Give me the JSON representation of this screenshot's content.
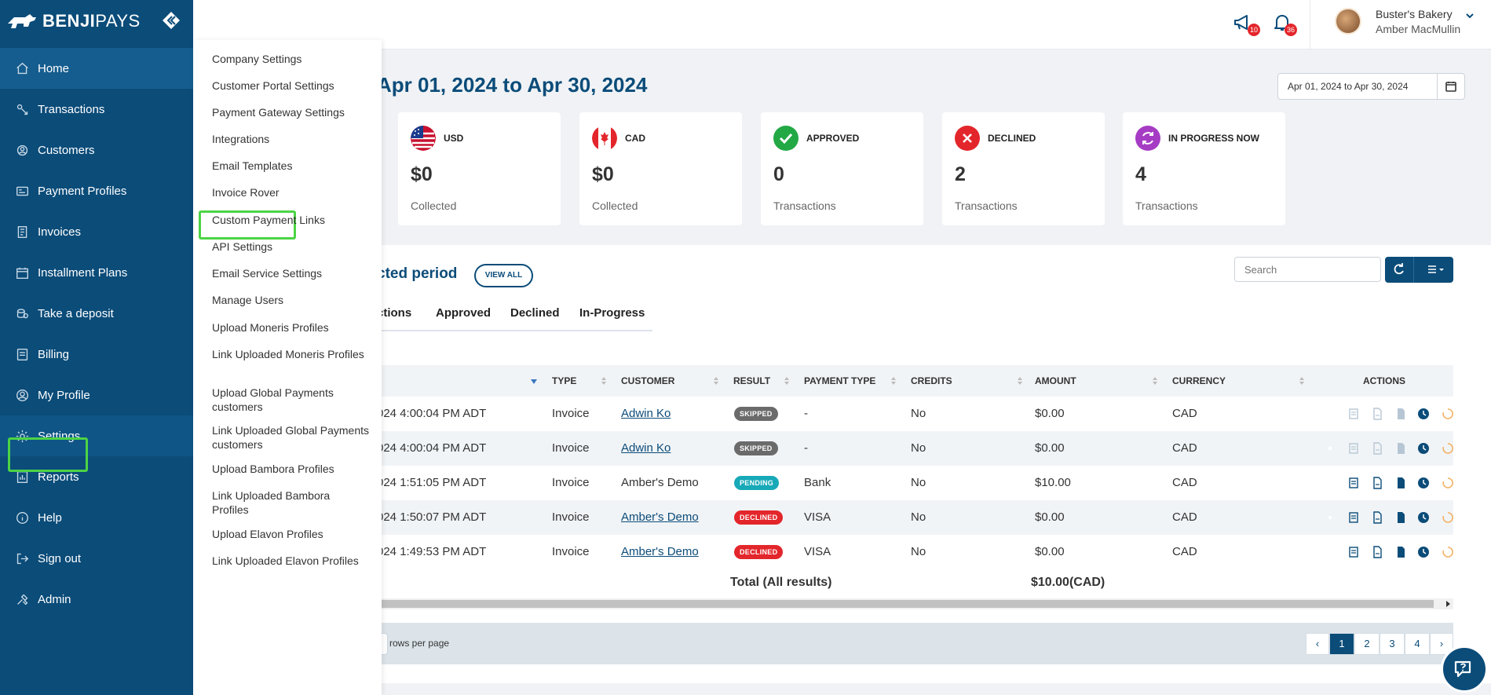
{
  "brand": {
    "name_bold": "BENJI",
    "name_light": "PAYS"
  },
  "colors": {
    "primary": "#0b4c79",
    "highlight": "#4cd445",
    "declined": "#e3262b",
    "approved": "#22a845",
    "pending": "#17a9b7",
    "skipped": "#6b6b6b",
    "in_progress": "#a63cc4"
  },
  "sidebar": {
    "items": [
      {
        "label": "Home",
        "icon": "home-icon"
      },
      {
        "label": "Transactions",
        "icon": "transactions-icon"
      },
      {
        "label": "Customers",
        "icon": "customers-icon"
      },
      {
        "label": "Payment Profiles",
        "icon": "payment-profiles-icon"
      },
      {
        "label": "Invoices",
        "icon": "invoice-icon"
      },
      {
        "label": "Installment Plans",
        "icon": "calendar-icon"
      },
      {
        "label": "Take a deposit",
        "icon": "deposit-icon"
      },
      {
        "label": "Billing",
        "icon": "billing-icon"
      },
      {
        "label": "My Profile",
        "icon": "profile-icon"
      },
      {
        "label": "Settings",
        "icon": "gear-icon"
      },
      {
        "label": "Reports",
        "icon": "reports-icon"
      },
      {
        "label": "Help",
        "icon": "help-icon"
      },
      {
        "label": "Sign out",
        "icon": "sign-out-icon"
      },
      {
        "label": "Admin",
        "icon": "admin-icon"
      }
    ]
  },
  "settings_menu": {
    "items": [
      "Company Settings",
      "Customer Portal Settings",
      "Payment Gateway Settings",
      "Integrations",
      "Email Templates",
      "Invoice Rover",
      "Custom Payment Links",
      "API Settings",
      "Email Service Settings",
      "Manage Users",
      "Upload Moneris Profiles",
      "Link Uploaded Moneris Profiles",
      "Upload Global Payments customers",
      "Link Uploaded Global Payments customers",
      "Upload Bambora Profiles",
      "Link Uploaded Bambora Profiles",
      "Upload Elavon Profiles",
      "Link Uploaded Elavon Profiles"
    ]
  },
  "header": {
    "announcements_count": "10",
    "notifications_count": "36",
    "company": "Buster's Bakery",
    "user": "Amber MacMullin"
  },
  "page": {
    "title": "Apr 01, 2024 to Apr 30, 2024",
    "date_range": "Apr 01, 2024 to Apr 30, 2024"
  },
  "cards": [
    {
      "label": "USD",
      "value": "$0",
      "sub": "Collected"
    },
    {
      "label": "CAD",
      "value": "$0",
      "sub": "Collected"
    },
    {
      "label": "APPROVED",
      "value": "0",
      "sub": "Transactions"
    },
    {
      "label": "DECLINED",
      "value": "2",
      "sub": "Transactions"
    },
    {
      "label": "IN PROGRESS NOW",
      "value": "4",
      "sub": "Transactions"
    }
  ],
  "transactions": {
    "section_title": "cted period",
    "view_all": "VIEW ALL",
    "search_placeholder": "Search",
    "tabs": [
      "ctions",
      "Approved",
      "Declined",
      "In-Progress"
    ],
    "columns": [
      "TYPE",
      "CUSTOMER",
      "RESULT",
      "PAYMENT TYPE",
      "CREDITS",
      "AMOUNT",
      "CURRENCY",
      "ACTIONS"
    ],
    "rows": [
      {
        "date": "024 4:00:04 PM ADT",
        "type": "Invoice",
        "customer": "Adwin Ko",
        "customer_link": true,
        "result": "SKIPPED",
        "payment_type": "-",
        "credits": "No",
        "amount": "$0.00",
        "currency": "CAD"
      },
      {
        "date": "024 4:00:04 PM ADT",
        "type": "Invoice",
        "customer": "Adwin Ko",
        "customer_link": true,
        "result": "SKIPPED",
        "payment_type": "-",
        "credits": "No",
        "amount": "$0.00",
        "currency": "CAD"
      },
      {
        "date": "024 1:51:05 PM ADT",
        "type": "Invoice",
        "customer": "Amber's Demo",
        "customer_link": false,
        "result": "PENDING",
        "payment_type": "Bank",
        "credits": "No",
        "amount": "$10.00",
        "currency": "CAD"
      },
      {
        "date": "024 1:50:07 PM ADT",
        "type": "Invoice",
        "customer": "Amber's Demo",
        "customer_link": true,
        "result": "DECLINED",
        "payment_type": "VISA",
        "credits": "No",
        "amount": "$0.00",
        "currency": "CAD"
      },
      {
        "date": "024 1:49:53 PM ADT",
        "type": "Invoice",
        "customer": "Amber's Demo",
        "customer_link": true,
        "result": "DECLINED",
        "payment_type": "VISA",
        "credits": "No",
        "amount": "$0.00",
        "currency": "CAD"
      }
    ],
    "total_label": "Total (All results)",
    "total_value": "$10.00(CAD)",
    "rows_per_page": "rows per page",
    "pages": [
      "‹",
      "1",
      "2",
      "3",
      "4",
      "›"
    ],
    "current_page": "1"
  }
}
